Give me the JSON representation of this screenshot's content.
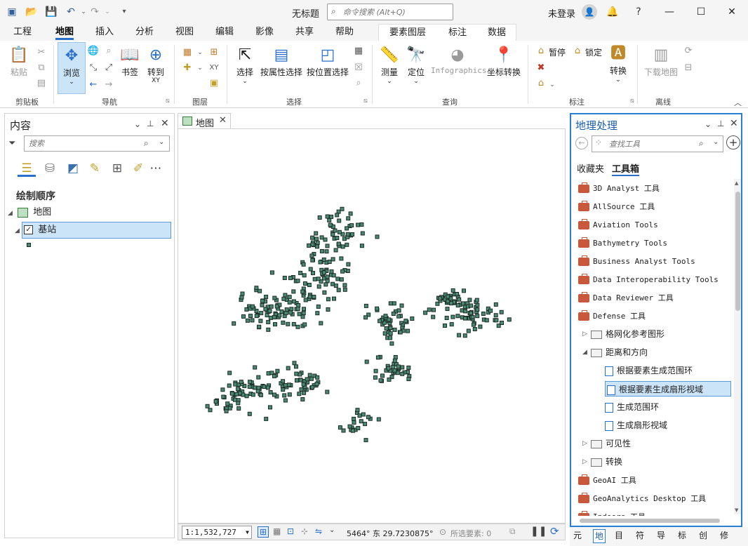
{
  "app": {
    "title": "无标题",
    "command_search_placeholder": "命令搜索 (Alt+Q)",
    "login_label": "未登录"
  },
  "ribbon_tabs": [
    "工程",
    "地图",
    "插入",
    "分析",
    "视图",
    "编辑",
    "影像",
    "共享",
    "帮助"
  ],
  "ribbon_active_tab": "地图",
  "context_tabs": [
    "要素图层",
    "标注",
    "数据"
  ],
  "ribbon_groups": {
    "clipboard": {
      "label": "剪贴板",
      "paste": "粘贴"
    },
    "navigate": {
      "label": "导航",
      "explore": "浏览",
      "bookmarks": "书签",
      "goto": "转到",
      "goto_sub": "XY"
    },
    "layer": {
      "label": "图层"
    },
    "selection": {
      "label": "选择",
      "select": "选择",
      "by_attr": "按属性选择",
      "by_loc": "按位置选择"
    },
    "inquiry": {
      "label": "查询",
      "measure": "测量",
      "locate": "定位",
      "infographics": "Infographics",
      "coord_convert": "坐标转换"
    },
    "labeling": {
      "label": "标注",
      "pause": "暂停",
      "lock": "锁定",
      "convert": "转换"
    },
    "offline": {
      "label": "离线",
      "download": "下载地图"
    }
  },
  "contents": {
    "title": "内容",
    "search_placeholder": "搜索",
    "drawing_order": "绘制顺序",
    "map_name": "地图",
    "layer_name": "基站"
  },
  "map_view": {
    "tab_label": "地图",
    "scale": "1:1,532,727",
    "coordinates": "5464° 东  29.7230875°",
    "selected_features": "所选要素: 0"
  },
  "geoprocessing": {
    "title": "地理处理",
    "search_placeholder": "查找工具",
    "tabs": [
      "收藏夹",
      "工具箱"
    ],
    "active_tab": "工具箱",
    "items": [
      {
        "kind": "toolbox",
        "label": "3D Analyst 工具",
        "level": 0
      },
      {
        "kind": "toolbox",
        "label": "AllSource 工具",
        "level": 0
      },
      {
        "kind": "toolbox",
        "label": "Aviation Tools",
        "level": 0
      },
      {
        "kind": "toolbox",
        "label": "Bathymetry Tools",
        "level": 0
      },
      {
        "kind": "toolbox",
        "label": "Business Analyst Tools",
        "level": 0
      },
      {
        "kind": "toolbox",
        "label": "Data Interoperability Tools",
        "level": 0
      },
      {
        "kind": "toolbox",
        "label": "Data Reviewer 工具",
        "level": 0
      },
      {
        "kind": "toolbox",
        "label": "Defense 工具",
        "level": 0,
        "expanded": true
      },
      {
        "kind": "toolset",
        "label": "格网化参考图形",
        "level": 1,
        "expanded": false
      },
      {
        "kind": "toolset",
        "label": "距离和方向",
        "level": 1,
        "expanded": true
      },
      {
        "kind": "tool",
        "label": "根据要素生成范围环",
        "level": 2
      },
      {
        "kind": "tool",
        "label": "根据要素生成扇形视域",
        "level": 2,
        "selected": true
      },
      {
        "kind": "tool",
        "label": "生成范围环",
        "level": 2
      },
      {
        "kind": "tool",
        "label": "生成扇形视域",
        "level": 2
      },
      {
        "kind": "toolset",
        "label": "可见性",
        "level": 1,
        "expanded": false
      },
      {
        "kind": "toolset",
        "label": "转换",
        "level": 1,
        "expanded": false
      },
      {
        "kind": "toolbox",
        "label": "GeoAI 工具",
        "level": 0
      },
      {
        "kind": "toolbox",
        "label": "GeoAnalytics Desktop 工具",
        "level": 0
      },
      {
        "kind": "toolbox",
        "label": "Indoors 工具",
        "level": 0
      }
    ]
  },
  "bottom_tabs": [
    "元",
    "地",
    "目",
    "符",
    "导",
    "标",
    "创",
    "修"
  ],
  "bottom_active_tab": "地",
  "colors": {
    "accent": "#2a6fcc",
    "point_fill": "#4a8a73",
    "point_stroke": "#1c2a25",
    "selection": "#cce4f7",
    "toolbox": "#c8583b"
  }
}
